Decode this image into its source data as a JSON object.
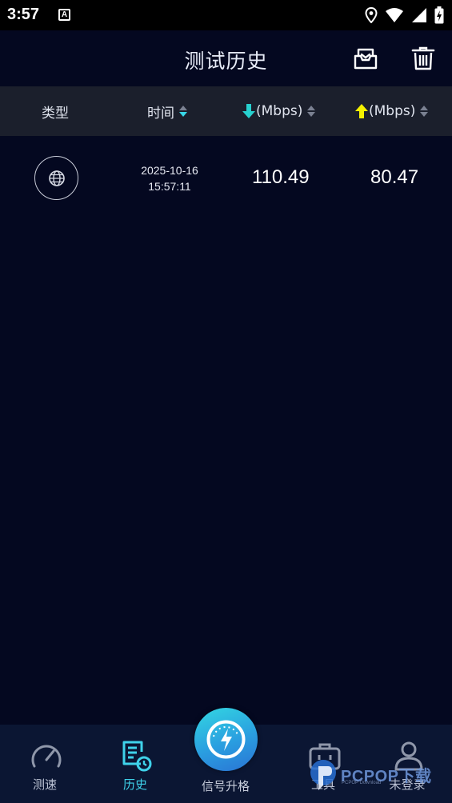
{
  "status_bar": {
    "time": "3:57",
    "notification_letter": "A"
  },
  "header": {
    "title": "测试历史",
    "icons": [
      "inbox-icon",
      "trash-icon"
    ]
  },
  "columns": {
    "type": "类型",
    "time": "时间",
    "download": "(Mbps)",
    "upload": "(Mbps)"
  },
  "colors": {
    "background": "#040820",
    "accent": "#3fd2ea",
    "download_arrow": "#27d0cf",
    "upload_arrow": "#f4f000"
  },
  "records": [
    {
      "type_icon": "globe-icon",
      "date": "2025-10-16",
      "time": "15:57:11",
      "download": "110.49",
      "upload": "80.47"
    }
  ],
  "nav": {
    "speed": "测速",
    "history": "历史",
    "boost": "信号升格",
    "tools": "工具",
    "account": "未登录"
  },
  "watermark": {
    "brand": "PCPOP下载",
    "sub": "PCPOP Download"
  }
}
